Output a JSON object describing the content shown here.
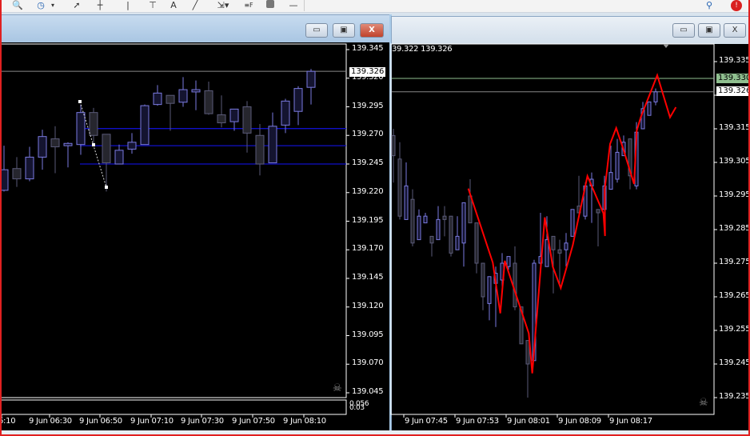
{
  "toolbar": {
    "icons": [
      "zoom-icon",
      "clock-icon",
      "cursor-icon",
      "crosshair-icon",
      "vertical-line-icon",
      "horizontal-line-icon",
      "text-icon",
      "trendline-icon",
      "arrows-icon",
      "fibonacci-icon",
      "rectangle-icon",
      "dash-icon",
      "search-icon",
      "notification-icon"
    ],
    "text_tool": "A",
    "notification_badge": "!"
  },
  "left_chart": {
    "window_buttons": {
      "minimize": "▭",
      "restore": "▣",
      "close": "X"
    },
    "price_ticks": [
      "139.345",
      "139.320",
      "139.295",
      "139.270",
      "139.245",
      "139.220",
      "139.195",
      "139.170",
      "139.145",
      "139.120",
      "139.095",
      "139.070",
      "139.045"
    ],
    "price_range": [
      139.045,
      139.345
    ],
    "current_price": "139.326",
    "sub_labels": [
      "0.056",
      "0.03"
    ],
    "time_labels": [
      "6:10",
      "9 Jun 06:30",
      "9 Jun 06:50",
      "9 Jun 07:10",
      "9 Jun 07:30",
      "9 Jun 07:50",
      "9 Jun 08:10"
    ],
    "levels": [
      139.276,
      139.261,
      139.245
    ],
    "line_color": "#1010c8",
    "candles": [
      [
        139.222,
        139.261,
        139.221,
        139.24
      ],
      [
        139.241,
        139.251,
        139.225,
        139.232
      ],
      [
        139.232,
        139.26,
        139.23,
        139.251
      ],
      [
        139.251,
        139.275,
        139.24,
        139.269
      ],
      [
        139.267,
        139.278,
        139.237,
        139.26
      ],
      [
        139.261,
        139.264,
        139.242,
        139.263
      ],
      [
        139.262,
        139.297,
        139.253,
        139.29
      ],
      [
        139.29,
        139.294,
        139.263,
        139.27
      ],
      [
        139.271,
        139.271,
        139.221,
        139.246
      ],
      [
        139.245,
        139.262,
        139.245,
        139.257
      ],
      [
        139.258,
        139.272,
        139.254,
        139.264
      ],
      [
        139.262,
        139.297,
        139.262,
        139.296
      ],
      [
        139.297,
        139.314,
        139.296,
        139.307
      ],
      [
        139.305,
        139.305,
        139.274,
        139.298
      ],
      [
        139.299,
        139.321,
        139.295,
        139.31
      ],
      [
        139.308,
        139.318,
        139.292,
        139.31
      ],
      [
        139.309,
        139.317,
        139.288,
        139.289
      ],
      [
        139.288,
        139.305,
        139.277,
        139.281
      ],
      [
        139.282,
        139.293,
        139.274,
        139.293
      ],
      [
        139.295,
        139.3,
        139.255,
        139.272
      ],
      [
        139.27,
        139.28,
        139.235,
        139.245
      ],
      [
        139.246,
        139.29,
        139.246,
        139.278
      ],
      [
        139.279,
        139.302,
        139.272,
        139.3
      ],
      [
        139.291,
        139.313,
        139.279,
        139.311
      ],
      [
        139.312,
        139.328,
        139.297,
        139.326
      ]
    ]
  },
  "right_chart": {
    "window_buttons": {
      "minimize": "▭",
      "restore": "▣",
      "close": "X"
    },
    "bid_ask": "39.322 139.326",
    "price_ticks": [
      "139.335",
      "139.325",
      "139.315",
      "139.305",
      "139.295",
      "139.285",
      "139.275",
      "139.265",
      "139.255",
      "139.245",
      "139.235"
    ],
    "price_range": [
      139.235,
      139.335
    ],
    "ask_price": "139.330",
    "current_price": "139.326",
    "ask_color": "#8fbf8f",
    "zigzag_color": "#ff0000",
    "time_labels": [
      "9 Jun 07:45",
      "9 Jun 07:53",
      "9 Jun 08:01",
      "9 Jun 08:09",
      "9 Jun 08:17"
    ],
    "candles": [
      [
        139.313,
        139.315,
        139.299,
        139.307
      ],
      [
        139.306,
        139.311,
        139.288,
        139.289
      ],
      [
        139.288,
        139.305,
        139.288,
        139.298
      ],
      [
        139.294,
        139.297,
        139.28,
        139.281
      ],
      [
        139.282,
        139.291,
        139.282,
        139.289
      ],
      [
        139.287,
        139.29,
        139.287,
        139.289
      ],
      [
        139.283,
        139.283,
        139.277,
        139.281
      ],
      [
        139.282,
        139.292,
        139.282,
        139.288
      ],
      [
        139.289,
        139.292,
        139.283,
        139.288
      ],
      [
        139.289,
        139.289,
        139.277,
        139.278
      ],
      [
        139.279,
        139.289,
        139.279,
        139.283
      ],
      [
        139.281,
        139.293,
        139.274,
        139.293
      ],
      [
        139.295,
        139.3,
        139.287,
        139.287
      ],
      [
        139.287,
        139.287,
        139.272,
        139.275
      ],
      [
        139.275,
        139.275,
        139.261,
        139.265
      ],
      [
        139.263,
        139.271,
        139.258,
        139.271
      ],
      [
        139.269,
        139.274,
        139.256,
        139.272
      ],
      [
        139.27,
        139.278,
        139.268,
        139.275
      ],
      [
        139.274,
        139.277,
        139.273,
        139.277
      ],
      [
        139.275,
        139.28,
        139.261,
        139.262
      ],
      [
        139.262,
        139.262,
        139.251,
        139.251
      ],
      [
        139.252,
        139.252,
        139.235,
        139.245
      ],
      [
        139.246,
        139.276,
        139.246,
        139.275
      ],
      [
        139.275,
        139.29,
        139.272,
        139.277
      ],
      [
        139.274,
        139.289,
        139.274,
        139.282
      ],
      [
        139.283,
        139.283,
        139.266,
        139.279
      ],
      [
        139.279,
        139.282,
        139.268,
        139.278
      ],
      [
        139.279,
        139.284,
        139.274,
        139.281
      ],
      [
        139.283,
        139.291,
        139.283,
        139.291
      ],
      [
        139.292,
        139.301,
        139.29,
        139.29
      ],
      [
        139.289,
        139.299,
        139.288,
        139.298
      ],
      [
        139.298,
        139.302,
        139.287,
        139.3
      ],
      [
        139.291,
        139.291,
        139.28,
        139.29
      ],
      [
        139.291,
        139.301,
        139.291,
        139.298
      ],
      [
        139.297,
        139.31,
        139.297,
        139.302
      ],
      [
        139.3,
        139.312,
        139.299,
        139.308
      ],
      [
        139.307,
        139.313,
        139.307,
        139.311
      ],
      [
        139.312,
        139.312,
        139.297,
        139.301
      ],
      [
        139.298,
        139.317,
        139.297,
        139.314
      ],
      [
        139.315,
        139.323,
        139.315,
        139.321
      ],
      [
        139.319,
        139.323,
        139.319,
        139.323
      ],
      [
        139.323,
        139.327,
        139.322,
        139.326
      ]
    ]
  }
}
